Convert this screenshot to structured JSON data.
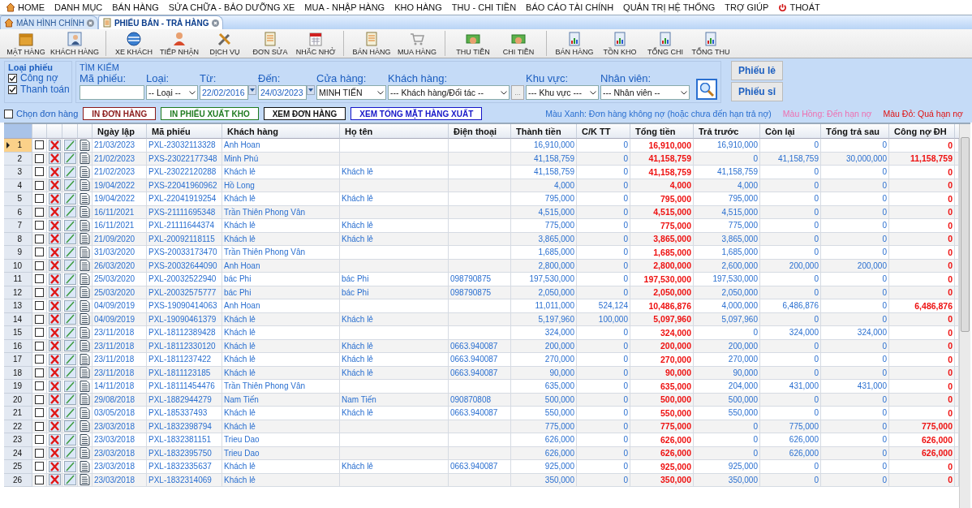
{
  "menu": [
    {
      "label": "HOME",
      "kind": "home"
    },
    {
      "label": "DANH MỤC"
    },
    {
      "label": "BÁN HÀNG"
    },
    {
      "label": "SỬA CHỮA - BẢO DƯỠNG XE"
    },
    {
      "label": "MUA - NHẬP HÀNG"
    },
    {
      "label": "KHO HÀNG"
    },
    {
      "label": "THU - CHI TIỀN"
    },
    {
      "label": "BÁO CÁO TÀI CHÍNH"
    },
    {
      "label": "QUẢN TRỊ HỆ THỐNG"
    },
    {
      "label": "TRỢ GIÚP"
    },
    {
      "label": "THOÁT",
      "kind": "power"
    }
  ],
  "tabs": [
    {
      "label": "MÀN HÌNH CHÍNH",
      "kind": "home",
      "selected": false
    },
    {
      "label": "PHIẾU BÁN - TRẢ HÀNG",
      "kind": "form",
      "selected": true
    }
  ],
  "toolbar": [
    [
      {
        "label": "MẶT HÀNG",
        "kind": "box"
      },
      {
        "label": "KHÁCH HÀNG",
        "kind": "contact"
      }
    ],
    [
      {
        "label": "XE KHÁCH",
        "kind": "globe"
      },
      {
        "label": "TIẾP NHẬN",
        "kind": "person"
      },
      {
        "label": "DỊCH VỤ",
        "kind": "tools"
      },
      {
        "label": "ĐƠN SỬA",
        "kind": "form"
      },
      {
        "label": "NHẮC NHỞ",
        "kind": "calendar"
      }
    ],
    [
      {
        "label": "BÁN HÀNG",
        "kind": "form"
      },
      {
        "label": "MUA HÀNG",
        "kind": "cart"
      }
    ],
    [
      {
        "label": "THU TIỀN",
        "kind": "money"
      },
      {
        "label": "CHI TIỀN",
        "kind": "money"
      }
    ],
    [
      {
        "label": "BÁN HÀNG",
        "kind": "chart"
      },
      {
        "label": "TỒN KHO",
        "kind": "chart"
      },
      {
        "label": "TỔNG CHI",
        "kind": "chart"
      },
      {
        "label": "TỔNG THU",
        "kind": "chart"
      }
    ]
  ],
  "voucher_type": {
    "title": "Loại phiếu",
    "options": [
      {
        "label": "Công nợ",
        "checked": true
      },
      {
        "label": "Thanh toán",
        "checked": true
      }
    ]
  },
  "search": {
    "title": "TÌM KIẾM",
    "fields": [
      {
        "label": "Mã phiếu:",
        "kind": "text"
      },
      {
        "label": "Loại:",
        "kind": "select",
        "value": "-- Loại --"
      },
      {
        "label": "Từ:",
        "kind": "date",
        "value": "22/02/2016"
      },
      {
        "label": "Đến:",
        "kind": "date",
        "value": "24/03/2023"
      },
      {
        "label": "Cửa hàng:",
        "kind": "select",
        "value": "MINH TIẾN"
      },
      {
        "label": "Khách hàng:",
        "kind": "picker",
        "value": "--- Khách hàng/Đối tác --",
        "button": "..."
      },
      {
        "label": "Khu vực:",
        "kind": "select",
        "value": "--- Khu vực ---"
      },
      {
        "label": "Nhân viên:",
        "kind": "select",
        "value": "--- Nhân viên --"
      }
    ]
  },
  "voucher_buttons": [
    "Phiếu lẻ",
    "Phiếu sỉ"
  ],
  "select_orders": {
    "label": "Chọn đơn hàng",
    "checked": false
  },
  "actions": [
    {
      "label": "IN ĐƠN HÀNG",
      "color": "#8b1a1a"
    },
    {
      "label": "IN PHIẾU XUẤT KHO",
      "color": "#1e7a1e"
    },
    {
      "label": "XEM ĐƠN HÀNG",
      "color": "#111111"
    },
    {
      "label": "XEM TỔNG MẶT HÀNG XUẤT",
      "color": "#1515c8"
    }
  ],
  "legend": [
    {
      "label": "Màu Xanh: Đơn hàng không nợ (hoặc chưa đến hạn trả nợ)",
      "color": "#2a6fd0"
    },
    {
      "label": "Màu Hồng: Đến hạn nợ",
      "color": "#ee6fb0"
    },
    {
      "label": "Màu Đỏ: Quá hạn nợ",
      "color": "#e01010"
    }
  ],
  "table": {
    "columns": [
      "Ngày lập",
      "Mã phiếu",
      "Khách hàng",
      "Họ tên",
      "Điện thoại",
      "Thành tiền",
      "C/K TT",
      "Tổng tiền",
      "Trả trước",
      "Còn lại",
      "Tổng trả sau",
      "Công nợ ĐH"
    ],
    "rows": [
      {
        "no": "1",
        "selected": true,
        "checked": false,
        "cells": [
          "21/03/2023",
          "PXL-23032113328",
          "Anh Hoan",
          "",
          "",
          "16,910,000",
          "0",
          "16,910,000",
          "16,910,000",
          "0",
          "0",
          "0"
        ]
      },
      {
        "no": "2",
        "selected": false,
        "checked": false,
        "cells": [
          "21/02/2023",
          "PXS-23022177348",
          "Minh Phú",
          "",
          "",
          "41,158,759",
          "0",
          "41,158,759",
          "0",
          "41,158,759",
          "30,000,000",
          "11,158,759"
        ]
      },
      {
        "no": "3",
        "selected": false,
        "checked": false,
        "cells": [
          "21/02/2023",
          "PXL-23022120288",
          "Khách lẻ",
          "Khách lẻ",
          "",
          "41,158,759",
          "0",
          "41,158,759",
          "41,158,759",
          "0",
          "0",
          "0"
        ]
      },
      {
        "no": "4",
        "selected": false,
        "checked": false,
        "cells": [
          "19/04/2022",
          "PXS-22041960962",
          "Hồ Long",
          "",
          "",
          "4,000",
          "0",
          "4,000",
          "4,000",
          "0",
          "0",
          "0"
        ]
      },
      {
        "no": "5",
        "selected": false,
        "checked": false,
        "cells": [
          "19/04/2022",
          "PXL-22041919254",
          "Khách lẻ",
          "Khách lẻ",
          "",
          "795,000",
          "0",
          "795,000",
          "795,000",
          "0",
          "0",
          "0"
        ]
      },
      {
        "no": "6",
        "selected": false,
        "checked": false,
        "cells": [
          "16/11/2021",
          "PXS-21111695348",
          "Trần Thiên Phong Vân",
          "",
          "",
          "4,515,000",
          "0",
          "4,515,000",
          "4,515,000",
          "0",
          "0",
          "0"
        ]
      },
      {
        "no": "7",
        "selected": false,
        "checked": false,
        "cells": [
          "16/11/2021",
          "PXL-21111644374",
          "Khách lẻ",
          "Khách lẻ",
          "",
          "775,000",
          "0",
          "775,000",
          "775,000",
          "0",
          "0",
          "0"
        ]
      },
      {
        "no": "8",
        "selected": false,
        "checked": false,
        "cells": [
          "21/09/2020",
          "PXL-20092118115",
          "Khách lẻ",
          "Khách lẻ",
          "",
          "3,865,000",
          "0",
          "3,865,000",
          "3,865,000",
          "0",
          "0",
          "0"
        ]
      },
      {
        "no": "9",
        "selected": false,
        "checked": false,
        "cells": [
          "31/03/2020",
          "PXS-20033173470",
          "Trần Thiên Phong Vân",
          "",
          "",
          "1,685,000",
          "0",
          "1,685,000",
          "1,685,000",
          "0",
          "0",
          "0"
        ]
      },
      {
        "no": "10",
        "selected": false,
        "checked": false,
        "cells": [
          "26/03/2020",
          "PXS-20032644090",
          "Anh Hoan",
          "",
          "",
          "2,800,000",
          "0",
          "2,800,000",
          "2,600,000",
          "200,000",
          "200,000",
          "0"
        ]
      },
      {
        "no": "11",
        "selected": false,
        "checked": false,
        "cells": [
          "25/03/2020",
          "PXL-20032522940",
          "bác Phi",
          "bác Phi",
          "098790875",
          "197,530,000",
          "0",
          "197,530,000",
          "197,530,000",
          "0",
          "0",
          "0"
        ]
      },
      {
        "no": "12",
        "selected": false,
        "checked": false,
        "cells": [
          "25/03/2020",
          "PXL-20032575777",
          "bác Phi",
          "bác Phi",
          "098790875",
          "2,050,000",
          "0",
          "2,050,000",
          "2,050,000",
          "0",
          "0",
          "0"
        ]
      },
      {
        "no": "13",
        "selected": false,
        "checked": false,
        "cells": [
          "04/09/2019",
          "PXS-19090414063",
          "Anh Hoan",
          "",
          "",
          "11,011,000",
          "524,124",
          "10,486,876",
          "4,000,000",
          "6,486,876",
          "0",
          "6,486,876"
        ]
      },
      {
        "no": "14",
        "selected": false,
        "checked": false,
        "cells": [
          "04/09/2019",
          "PXL-19090461379",
          "Khách lẻ",
          "Khách lẻ",
          "",
          "5,197,960",
          "100,000",
          "5,097,960",
          "5,097,960",
          "0",
          "0",
          "0"
        ]
      },
      {
        "no": "15",
        "selected": false,
        "checked": false,
        "cells": [
          "23/11/2018",
          "PXL-18112389428",
          "Khách lẻ",
          "",
          "",
          "324,000",
          "0",
          "324,000",
          "0",
          "324,000",
          "324,000",
          "0"
        ]
      },
      {
        "no": "16",
        "selected": false,
        "checked": false,
        "cells": [
          "23/11/2018",
          "PXL-18112330120",
          "Khách lẻ",
          "Khách lẻ",
          "0663.940087",
          "200,000",
          "0",
          "200,000",
          "200,000",
          "0",
          "0",
          "0"
        ]
      },
      {
        "no": "17",
        "selected": false,
        "checked": false,
        "cells": [
          "23/11/2018",
          "PXL-1811237422",
          "Khách lẻ",
          "Khách lẻ",
          "0663.940087",
          "270,000",
          "0",
          "270,000",
          "270,000",
          "0",
          "0",
          "0"
        ]
      },
      {
        "no": "18",
        "selected": false,
        "checked": false,
        "cells": [
          "23/11/2018",
          "PXL-1811123185",
          "Khách lẻ",
          "Khách lẻ",
          "0663.940087",
          "90,000",
          "0",
          "90,000",
          "90,000",
          "0",
          "0",
          "0"
        ]
      },
      {
        "no": "19",
        "selected": false,
        "checked": false,
        "cells": [
          "14/11/2018",
          "PXL-18111454476",
          "Trần Thiên Phong Vân",
          "",
          "",
          "635,000",
          "0",
          "635,000",
          "204,000",
          "431,000",
          "431,000",
          "0"
        ]
      },
      {
        "no": "20",
        "selected": false,
        "checked": false,
        "cells": [
          "29/08/2018",
          "PXL-1882944279",
          "Nam Tiến",
          "Nam Tiến",
          "090870808",
          "500,000",
          "0",
          "500,000",
          "500,000",
          "0",
          "0",
          "0"
        ]
      },
      {
        "no": "21",
        "selected": false,
        "checked": false,
        "cells": [
          "03/05/2018",
          "PXL-185337493",
          "Khách lẻ",
          "Khách lẻ",
          "0663.940087",
          "550,000",
          "0",
          "550,000",
          "550,000",
          "0",
          "0",
          "0"
        ]
      },
      {
        "no": "22",
        "selected": false,
        "checked": false,
        "cells": [
          "23/03/2018",
          "PXL-1832398794",
          "Khách lẻ",
          "",
          "",
          "775,000",
          "0",
          "775,000",
          "0",
          "775,000",
          "0",
          "775,000"
        ]
      },
      {
        "no": "23",
        "selected": false,
        "checked": false,
        "cells": [
          "23/03/2018",
          "PXL-1832381151",
          "Trieu Dao",
          "",
          "",
          "626,000",
          "0",
          "626,000",
          "0",
          "626,000",
          "0",
          "626,000"
        ]
      },
      {
        "no": "24",
        "selected": false,
        "checked": false,
        "cells": [
          "23/03/2018",
          "PXL-1832395750",
          "Trieu Dao",
          "",
          "",
          "626,000",
          "0",
          "626,000",
          "0",
          "626,000",
          "0",
          "626,000"
        ]
      },
      {
        "no": "25",
        "selected": false,
        "checked": false,
        "cells": [
          "23/03/2018",
          "PXL-1832335637",
          "Khách lẻ",
          "Khách lẻ",
          "0663.940087",
          "925,000",
          "0",
          "925,000",
          "925,000",
          "0",
          "0",
          "0"
        ]
      },
      {
        "no": "26",
        "selected": false,
        "checked": false,
        "cells": [
          "23/03/2018",
          "PXL-1832314069",
          "Khách lẻ",
          "",
          "",
          "350,000",
          "0",
          "350,000",
          "350,000",
          "0",
          "0",
          "0"
        ]
      }
    ]
  }
}
